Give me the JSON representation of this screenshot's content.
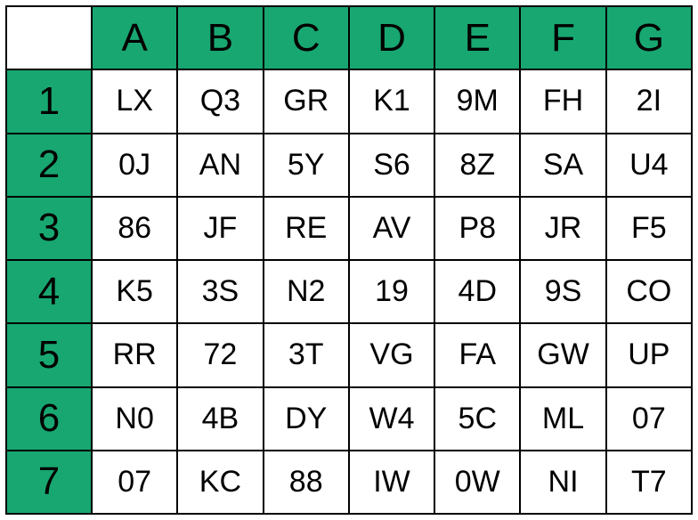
{
  "columns": [
    "A",
    "B",
    "C",
    "D",
    "E",
    "F",
    "G"
  ],
  "rows": [
    "1",
    "2",
    "3",
    "4",
    "5",
    "6",
    "7"
  ],
  "cells": [
    [
      "LX",
      "Q3",
      "GR",
      "K1",
      "9M",
      "FH",
      "2I"
    ],
    [
      "0J",
      "AN",
      "5Y",
      "S6",
      "8Z",
      "SA",
      "U4"
    ],
    [
      "86",
      "JF",
      "RE",
      "AV",
      "P8",
      "JR",
      "F5"
    ],
    [
      "K5",
      "3S",
      "N2",
      "19",
      "4D",
      "9S",
      "CO"
    ],
    [
      "RR",
      "72",
      "3T",
      "VG",
      "FA",
      "GW",
      "UP"
    ],
    [
      "N0",
      "4B",
      "DY",
      "W4",
      "5C",
      "ML",
      "07"
    ],
    [
      "07",
      "KC",
      "88",
      "IW",
      "0W",
      "NI",
      "T7"
    ]
  ],
  "chart_data": {
    "type": "table",
    "columns": [
      "A",
      "B",
      "C",
      "D",
      "E",
      "F",
      "G"
    ],
    "row_labels": [
      "1",
      "2",
      "3",
      "4",
      "5",
      "6",
      "7"
    ],
    "values": [
      [
        "LX",
        "Q3",
        "GR",
        "K1",
        "9M",
        "FH",
        "2I"
      ],
      [
        "0J",
        "AN",
        "5Y",
        "S6",
        "8Z",
        "SA",
        "U4"
      ],
      [
        "86",
        "JF",
        "RE",
        "AV",
        "P8",
        "JR",
        "F5"
      ],
      [
        "K5",
        "3S",
        "N2",
        "19",
        "4D",
        "9S",
        "CO"
      ],
      [
        "RR",
        "72",
        "3T",
        "VG",
        "FA",
        "GW",
        "UP"
      ],
      [
        "N0",
        "4B",
        "DY",
        "W4",
        "5C",
        "ML",
        "07"
      ],
      [
        "07",
        "KC",
        "88",
        "IW",
        "0W",
        "NI",
        "T7"
      ]
    ]
  }
}
